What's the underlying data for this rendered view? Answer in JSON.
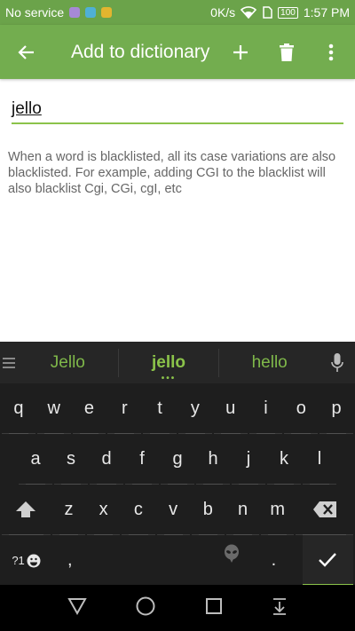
{
  "status": {
    "carrier": "No service",
    "speed": "0K/s",
    "battery": "100",
    "time": "1:57 PM"
  },
  "toolbar": {
    "title": "Add to dictionary",
    "back_icon": "arrow-left-icon",
    "add_icon": "plus-icon",
    "delete_icon": "trash-icon",
    "more_icon": "more-vert-icon"
  },
  "form": {
    "word_value": "jello",
    "hint": "When a word is blacklisted, all its case variations are also blacklisted. For example, adding CGI to the blacklist will also blacklist Cgi, CGi, cgI, etc"
  },
  "keyboard": {
    "suggestions": [
      "Jello",
      "jello",
      "hello"
    ],
    "suggestion_dots": "•••",
    "row1": [
      "q",
      "w",
      "e",
      "r",
      "t",
      "y",
      "u",
      "i",
      "o",
      "p"
    ],
    "row2": [
      "a",
      "s",
      "d",
      "f",
      "g",
      "h",
      "j",
      "k",
      "l"
    ],
    "row3": [
      "z",
      "x",
      "c",
      "v",
      "b",
      "n",
      "m"
    ],
    "symbols_key": "?1",
    "comma_key": ",",
    "period_key": ".",
    "colors": {
      "accent": "#8bc34a",
      "keyboard_bg": "#1e1e1e"
    }
  },
  "navigation": {
    "back_icon": "triangle-back-icon",
    "home_icon": "circle-home-icon",
    "recents_icon": "square-recents-icon",
    "hide_keyboard_icon": "hide-keyboard-icon"
  }
}
